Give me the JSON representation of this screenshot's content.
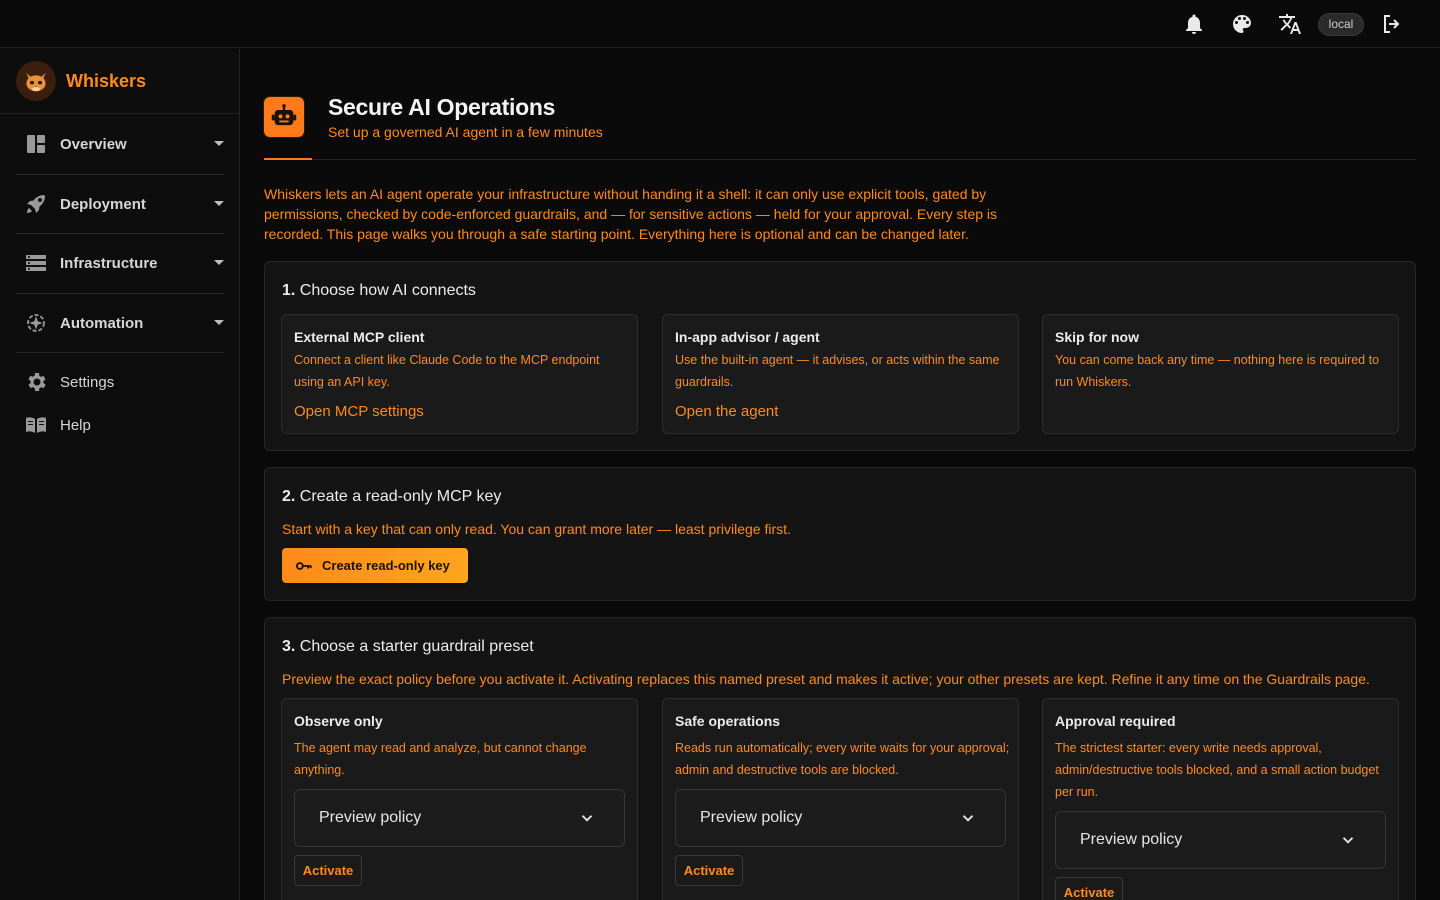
{
  "topbar": {
    "icons": [
      "bell-icon",
      "palette-icon",
      "translate-icon",
      "logout-icon"
    ],
    "env_badge": "local"
  },
  "brand": {
    "name": "Whiskers",
    "logo_icon": "cat-logo-icon"
  },
  "sidebar": {
    "items": [
      {
        "label": "Overview",
        "icon": "dashboard-icon",
        "expandable": true
      },
      {
        "label": "Deployment",
        "icon": "rocket-icon",
        "expandable": true
      },
      {
        "label": "Infrastructure",
        "icon": "server-list-icon",
        "expandable": true
      },
      {
        "label": "Automation",
        "icon": "automation-icon",
        "expandable": true
      },
      {
        "label": "Settings",
        "icon": "gear-icon",
        "expandable": false
      },
      {
        "label": "Help",
        "icon": "book-icon",
        "expandable": false
      }
    ]
  },
  "header": {
    "icon": "robot-icon",
    "title": "Secure AI Operations",
    "subtitle": "Set up a governed AI agent in a few minutes"
  },
  "intro": "Whiskers lets an AI agent operate your infrastructure without handing it a shell: it can only use explicit tools, gated by permissions, checked by code-enforced guardrails, and — for sensitive actions — held for your approval. Every step is recorded. This page walks you through a safe starting point. Everything here is optional and can be changed later.",
  "step1": {
    "number": "1.",
    "title": "Choose how AI connects",
    "options": [
      {
        "title": "External MCP client",
        "desc": "Connect a client like Claude Code to the MCP endpoint using an API key.",
        "link": "Open MCP settings"
      },
      {
        "title": "In-app advisor / agent",
        "desc": "Use the built-in agent — it advises, or acts within the same guardrails.",
        "link": "Open the agent"
      },
      {
        "title": "Skip for now",
        "desc": "You can come back any time — nothing here is required to run Whiskers.",
        "link": ""
      }
    ]
  },
  "step2": {
    "number": "2.",
    "title": "Create a read-only MCP key",
    "desc": "Start with a key that can only read. You can grant more later — least privilege first.",
    "button_label": "Create read-only key",
    "button_icon": "key-icon"
  },
  "step3": {
    "number": "3.",
    "title": "Choose a starter guardrail preset",
    "desc": "Preview the exact policy before you activate it. Activating replaces this named preset and makes it active; your other presets are kept. Refine it any time on the Guardrails page.",
    "presets": [
      {
        "title": "Observe only",
        "desc": "The agent may read and analyze, but cannot change anything.",
        "preview_label": "Preview policy",
        "activate_label": "Activate"
      },
      {
        "title": "Safe operations",
        "desc": "Reads run automatically; every write waits for your approval; admin and destructive tools are blocked.",
        "preview_label": "Preview policy",
        "activate_label": "Activate"
      },
      {
        "title": "Approval required",
        "desc": "The strictest starter: every write needs approval, admin/destructive tools blocked, and a small action budget per run.",
        "preview_label": "Preview policy",
        "activate_label": "Activate"
      }
    ]
  },
  "colors": {
    "accent": "#ff8a1a",
    "background": "#0a0a0a",
    "card": "#141414"
  }
}
